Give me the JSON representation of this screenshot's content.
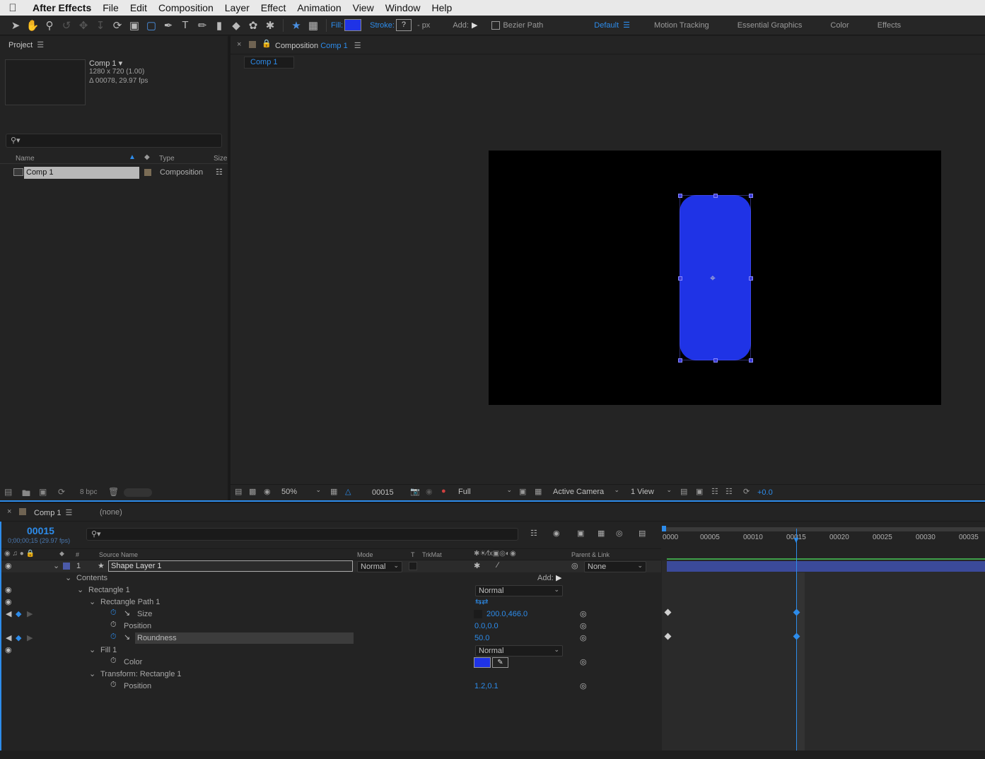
{
  "menubar": {
    "app_name": "After Effects",
    "items": [
      "File",
      "Edit",
      "Composition",
      "Layer",
      "Effect",
      "Animation",
      "View",
      "Window",
      "Help"
    ]
  },
  "toolbar": {
    "fill_label": "Fill:",
    "stroke_label": "Stroke:",
    "stroke_value": "?",
    "stroke_unit": "- px",
    "add_label": "Add:",
    "bezier_label": "Bezier Path",
    "workspaces": [
      "Default",
      "Motion Tracking",
      "Essential Graphics",
      "Color",
      "Effects"
    ],
    "fill_color": "#1f33e6"
  },
  "project": {
    "tab": "Project",
    "comp_name": "Comp 1",
    "comp_dims": "1280 x 720 (1.00)",
    "comp_duration": "Δ 00078, 29.97 fps",
    "col_name": "Name",
    "col_type": "Type",
    "col_size": "Size",
    "items": [
      {
        "name": "Comp 1",
        "type": "Composition"
      }
    ],
    "bpc": "8 bpc"
  },
  "composition": {
    "tab_prefix": "Composition",
    "tab_name": "Comp 1",
    "breadcrumb": "Comp 1",
    "zoom": "50%",
    "timecode": "00015",
    "resolution": "Full",
    "camera": "Active Camera",
    "view": "1 View",
    "exposure": "+0.0",
    "shape_color": "#1f33e6"
  },
  "timeline": {
    "tab": "Comp 1",
    "none_label": "(none)",
    "current_time": "00015",
    "current_time_sub": "0;00;00;15 (29.97 fps)",
    "col_source": "Source Name",
    "col_mode": "Mode",
    "col_t": "T",
    "col_trkmat": "TrkMat",
    "col_parent": "Parent & Link",
    "layer": {
      "index": "1",
      "name": "Shape Layer 1",
      "mode": "Normal",
      "parent": "None"
    },
    "props": {
      "contents": "Contents",
      "add": "Add:",
      "rectangle": "Rectangle 1",
      "rect_mode": "Normal",
      "rect_path": "Rectangle Path 1",
      "size": "Size",
      "size_value": "200.0,466.0",
      "position": "Position",
      "position_value": "0.0,0.0",
      "roundness": "Roundness",
      "roundness_value": "50.0",
      "fill": "Fill 1",
      "fill_mode": "Normal",
      "color": "Color",
      "transform": "Transform: Rectangle 1",
      "t_position": "Position",
      "t_position_value": "1.2,0.1"
    },
    "ruler": [
      "0000",
      "00005",
      "00010",
      "00015",
      "00020",
      "00025",
      "00030",
      "00035"
    ]
  }
}
